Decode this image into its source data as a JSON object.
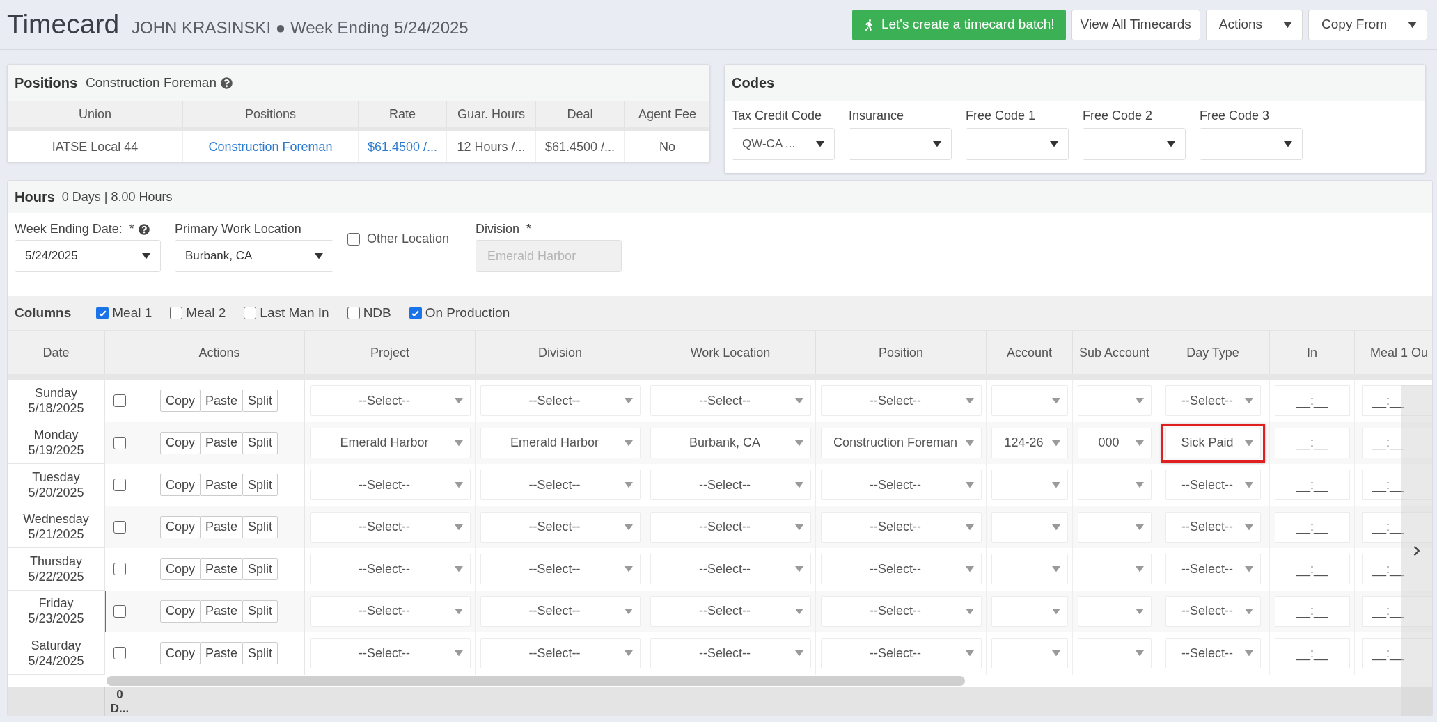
{
  "header": {
    "title": "Timecard",
    "subtitle": "JOHN KRASINSKI ● Week Ending 5/24/2025"
  },
  "buttons": [
    {
      "label": "Let's create a timecard batch!",
      "kind": "primary"
    },
    {
      "label": "View All Timecards",
      "kind": "plain"
    },
    {
      "label": "Actions",
      "kind": "dropdown"
    },
    {
      "label": "Copy From",
      "kind": "dropdown"
    }
  ],
  "positions": {
    "title": "Positions",
    "subtitle": "Construction Foreman",
    "columns": [
      "Union",
      "Positions",
      "Rate",
      "Guar. Hours",
      "Deal",
      "Agent Fee"
    ],
    "rows": [
      {
        "cells": [
          {
            "text": "IATSE Local 44",
            "kind": "text"
          },
          {
            "text": "Construction Foreman",
            "kind": "link"
          },
          {
            "text": "$61.4500 /...",
            "kind": "link"
          },
          {
            "text": "12 Hours /...",
            "kind": "text"
          },
          {
            "text": "$61.4500 /...",
            "kind": "text"
          },
          {
            "text": "No",
            "kind": "text"
          }
        ]
      }
    ]
  },
  "codes": {
    "title": "Codes",
    "fields": [
      {
        "label": "Tax Credit Code",
        "value": "QW-CA ..."
      },
      {
        "label": "Insurance"
      },
      {
        "label": "Free Code 1"
      },
      {
        "label": "Free Code 2"
      },
      {
        "label": "Free Code 3"
      }
    ]
  },
  "hours": {
    "title": "Hours",
    "summary": "0 Days | 8.00 Hours",
    "fields": [
      {
        "kind": "select",
        "label": "Week Ending Date:",
        "mark": "*",
        "help": true,
        "value": "5/24/2025"
      },
      {
        "kind": "select",
        "label": "Primary Work Location",
        "value": "Burbank, CA"
      },
      {
        "kind": "checkbox",
        "label": "Other Location",
        "checked": false
      },
      {
        "kind": "readonly",
        "label": "Division",
        "mark": "*",
        "value": "Emerald Harbor"
      }
    ],
    "columns_bar": {
      "label": "Columns",
      "options": [
        {
          "label": "Meal 1",
          "checked": true
        },
        {
          "label": "Meal 2",
          "checked": false
        },
        {
          "label": "Last Man In",
          "checked": false
        },
        {
          "label": "NDB",
          "checked": false
        },
        {
          "label": "On Production",
          "checked": true
        }
      ]
    }
  },
  "table": {
    "columns": [
      "Date",
      "Actions",
      "Project",
      "Division",
      "Work Location",
      "Position",
      "Account",
      "Sub Account",
      "Day Type",
      "In",
      "Meal 1 Ou"
    ],
    "rows": [
      {
        "day": "Sunday",
        "date": "5/18/2025",
        "checked": false,
        "focused": false,
        "actions": [
          "Copy",
          "Paste",
          "Split"
        ],
        "project": "--Select--",
        "division": "--Select--",
        "work_location": "--Select--",
        "position": "--Select--",
        "day_type": "--Select--",
        "highlighted": false,
        "in": "__:__",
        "meal_1_out": "__:__"
      },
      {
        "day": "Monday",
        "date": "5/19/2025",
        "checked": false,
        "focused": false,
        "actions": [
          "Copy",
          "Paste",
          "Split"
        ],
        "project": "Emerald Harbor",
        "division": "Emerald Harbor",
        "work_location": "Burbank, CA",
        "position": "Construction Foreman",
        "account": "124-26",
        "sub_account": "000",
        "day_type": "Sick Paid",
        "highlighted": true,
        "in": "__:__",
        "meal_1_out": "__:__"
      },
      {
        "day": "Tuesday",
        "date": "5/20/2025",
        "checked": false,
        "focused": false,
        "actions": [
          "Copy",
          "Paste",
          "Split"
        ],
        "project": "--Select--",
        "division": "--Select--",
        "work_location": "--Select--",
        "position": "--Select--",
        "day_type": "--Select--",
        "highlighted": false,
        "in": "__:__",
        "meal_1_out": "__:__"
      },
      {
        "day": "Wednesday",
        "date": "5/21/2025",
        "checked": false,
        "focused": false,
        "actions": [
          "Copy",
          "Paste",
          "Split"
        ],
        "project": "--Select--",
        "division": "--Select--",
        "work_location": "--Select--",
        "position": "--Select--",
        "day_type": "--Select--",
        "highlighted": false,
        "in": "__:__",
        "meal_1_out": "__:__"
      },
      {
        "day": "Thursday",
        "date": "5/22/2025",
        "checked": false,
        "focused": false,
        "actions": [
          "Copy",
          "Paste",
          "Split"
        ],
        "project": "--Select--",
        "division": "--Select--",
        "work_location": "--Select--",
        "position": "--Select--",
        "day_type": "--Select--",
        "highlighted": false,
        "in": "__:__",
        "meal_1_out": "__:__"
      },
      {
        "day": "Friday",
        "date": "5/23/2025",
        "checked": false,
        "focused": true,
        "actions": [
          "Copy",
          "Paste",
          "Split"
        ],
        "project": "--Select--",
        "division": "--Select--",
        "work_location": "--Select--",
        "position": "--Select--",
        "day_type": "--Select--",
        "highlighted": false,
        "in": "__:__",
        "meal_1_out": "__:__"
      },
      {
        "day": "Saturday",
        "date": "5/24/2025",
        "checked": false,
        "focused": false,
        "actions": [
          "Copy",
          "Paste",
          "Split"
        ],
        "project": "--Select--",
        "division": "--Select--",
        "work_location": "--Select--",
        "position": "--Select--",
        "day_type": "--Select--",
        "highlighted": false,
        "in": "__:__",
        "meal_1_out": "__:__"
      }
    ],
    "footer": "0 D..."
  }
}
